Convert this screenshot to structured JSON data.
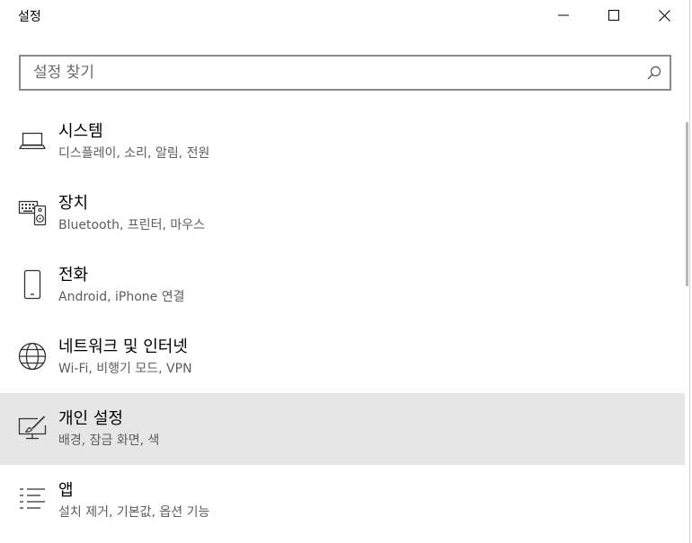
{
  "window": {
    "title": "설정",
    "minimize_icon": "minimize-icon",
    "maximize_icon": "maximize-icon",
    "close_icon": "close-icon"
  },
  "search": {
    "placeholder": "설정 찾기",
    "value": "",
    "icon": "search-icon"
  },
  "categories": [
    {
      "icon": "laptop-icon",
      "title": "시스템",
      "subtitle": "디스플레이, 소리, 알림, 전원",
      "selected": false
    },
    {
      "icon": "keyboard-speaker-icon",
      "title": "장치",
      "subtitle": "Bluetooth, 프린터, 마우스",
      "selected": false
    },
    {
      "icon": "phone-icon",
      "title": "전화",
      "subtitle": "Android, iPhone 연결",
      "selected": false
    },
    {
      "icon": "globe-icon",
      "title": "네트워크 및 인터넷",
      "subtitle": "Wi-Fi, 비행기 모드, VPN",
      "selected": false
    },
    {
      "icon": "personalization-icon",
      "title": "개인 설정",
      "subtitle": "배경, 잠금 화면, 색",
      "selected": true
    },
    {
      "icon": "apps-list-icon",
      "title": "앱",
      "subtitle": "설치 제거, 기본값, 옵션 기능",
      "selected": false
    }
  ],
  "colors": {
    "selected_background": "#e6e6e6",
    "subtitle_text": "#5d5d5d",
    "search_border": "#8a8a8a"
  }
}
